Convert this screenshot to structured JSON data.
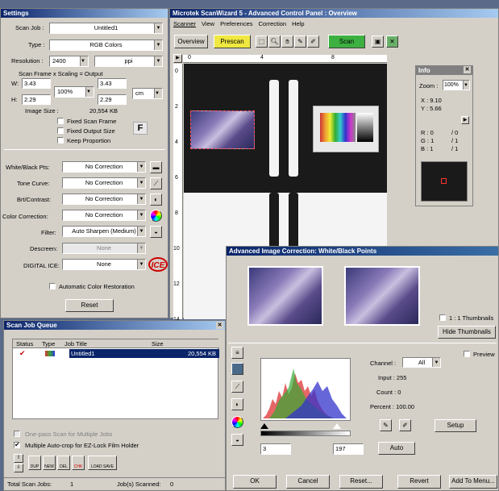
{
  "settings": {
    "title": "Settings",
    "scan_job_label": "Scan Job :",
    "scan_job_value": "Untitled1",
    "type_label": "Type :",
    "type_value": "RGB Colors",
    "resolution_label": "Resolution :",
    "resolution_value": "2400",
    "resolution_unit": "ppi",
    "frame_header": "Scan Frame  x  Scaling  =  Output",
    "w_label": "W:",
    "w_value": "3.43",
    "scale_value": "100%",
    "out_w": "3.43",
    "unit": "cm",
    "h_label": "H:",
    "h_value": "2.29",
    "out_h": "2.29",
    "image_size_label": "Image Size :",
    "image_size_value": "20,554 KB",
    "fixed_frame": "Fixed Scan Frame",
    "fixed_output": "Fixed Output Size",
    "keep_prop": "Keep Proportion",
    "f_badge": "F",
    "wb_label": "White/Black Pts:",
    "wb_value": "No Correction",
    "tone_label": "Tone Curve:",
    "tone_value": "No Correction",
    "brt_label": "Brt/Contrast:",
    "brt_value": "No Correction",
    "cc_label": "Color Correction:",
    "cc_value": "No Correction",
    "filter_label": "Filter:",
    "filter_value": "Auto Sharpen (Medium)",
    "descreen_label": "Descreen:",
    "descreen_value": "None",
    "ice_label": "DIGITAL ICE:",
    "ice_value": "None",
    "ice_logo": "ICE",
    "auto_restore": "Automatic Color Restoration",
    "reset": "Reset"
  },
  "main": {
    "title": "Microtek ScanWizard 5 - Advanced Control Panel : Overview",
    "menu": [
      "Scanner",
      "View",
      "Preferences",
      "Correction",
      "Help"
    ],
    "overview": "Overview",
    "prescan": "Prescan",
    "scan": "Scan",
    "ruler_top": [
      "0",
      "4",
      "8"
    ],
    "ruler_left": [
      "0",
      "2",
      "4",
      "6",
      "8",
      "10",
      "12",
      "14"
    ]
  },
  "info": {
    "title": "Info",
    "zoom_label": "Zoom :",
    "zoom_value": "100%",
    "x": "X : 9.10",
    "y": "Y : 5.66",
    "r": "R : 0",
    "r2": "/ 0",
    "g": "G : 1",
    "g2": "/ 1",
    "b": "B : 1",
    "b2": "/ 1"
  },
  "queue": {
    "title": "Scan Job Queue",
    "col_status": "Status",
    "col_type": "Type",
    "col_job": "Job Title",
    "col_size": "Size",
    "row_job": "Untitled1",
    "row_size": "20,554 KB",
    "one_pass": "One-pass Scan for Multiple Jobs",
    "multi_crop": "Multiple Auto-crop for EZ-Lock Film Holder",
    "icons": [
      "DUP",
      "NEW",
      "DEL",
      "CHK",
      "LOAD SAVE"
    ],
    "total_label": "Total Scan Jobs:",
    "total_value": "1",
    "scanned_label": "Job(s) Scanned:",
    "scanned_value": "0"
  },
  "aic": {
    "title": "Advanced Image Correction: White/Black Points",
    "thumb_1to1": "1 : 1 Thumbnails",
    "hide_thumbs": "Hide Thumbnails",
    "preview": "Preview",
    "channel_label": "Channel :",
    "channel_value": "All",
    "input_label": "Input : 255",
    "count_label": "Count : 0",
    "percent_label": "Percent : 100.00",
    "setup": "Setup",
    "low_value": "3",
    "high_value": "197",
    "auto": "Auto",
    "ok": "OK",
    "cancel": "Cancel",
    "reset": "Reset...",
    "revert": "Revert",
    "add_menu": "Add To Menu..."
  }
}
